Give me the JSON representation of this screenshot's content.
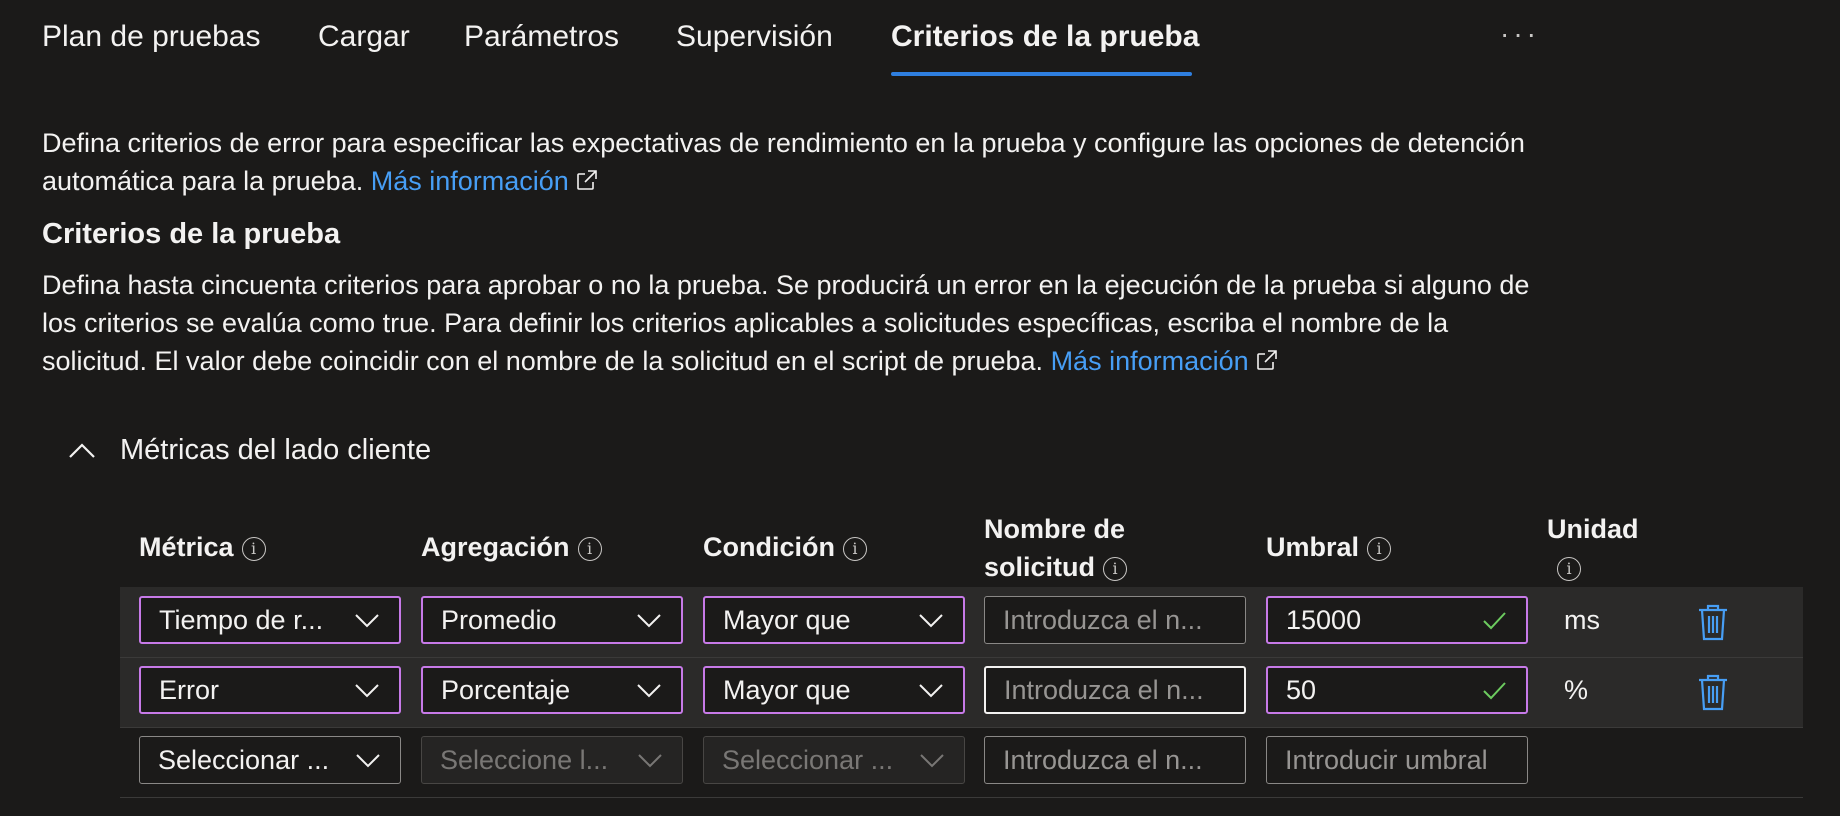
{
  "tabs": [
    {
      "label": "Plan de pruebas"
    },
    {
      "label": "Cargar"
    },
    {
      "label": "Parámetros"
    },
    {
      "label": "Supervisión"
    },
    {
      "label": "Criterios de la prueba",
      "active": true
    }
  ],
  "more_label": "···",
  "intro": {
    "text": "Defina criterios de error para especificar las expectativas de rendimiento en la prueba y configure las opciones de detención automática para la prueba.",
    "link": "Más información"
  },
  "criteria": {
    "heading": "Criterios de la prueba",
    "text": "Defina hasta cincuenta criterios para aprobar o no la prueba. Se producirá un error en la ejecución de la prueba si alguno de los criterios se evalúa como true. Para definir los criterios aplicables a solicitudes específicas, escriba el nombre de la solicitud. El valor debe coincidir con el nombre de la solicitud en el script de prueba.",
    "link": "Más información"
  },
  "section": {
    "title": "Métricas del lado cliente",
    "expanded": true
  },
  "table": {
    "headers": {
      "metric": "Métrica",
      "aggregation": "Agregación",
      "condition": "Condición",
      "request_line1": "Nombre de",
      "request_line2": "solicitud",
      "threshold": "Umbral",
      "unit": "Unidad"
    },
    "rows": [
      {
        "metric": "Tiempo de r...",
        "aggregation": "Promedio",
        "condition": "Mayor que",
        "request_placeholder": "Introduzca el n...",
        "threshold": "15000",
        "unit": "ms"
      },
      {
        "metric": "Error",
        "aggregation": "Porcentaje",
        "condition": "Mayor que",
        "request_placeholder": "Introduzca el n...",
        "threshold": "50",
        "unit": "%"
      },
      {
        "metric_placeholder": "Seleccionar ...",
        "aggregation_placeholder": "Seleccione l...",
        "condition_placeholder": "Seleccionar ...",
        "request_placeholder": "Introduzca el n...",
        "threshold_placeholder": "Introducir umbral"
      }
    ]
  },
  "colors": {
    "accent": "#2f7fe0",
    "link": "#479ef5",
    "selected_border": "#c77ae8",
    "check": "#6ccb5f"
  }
}
